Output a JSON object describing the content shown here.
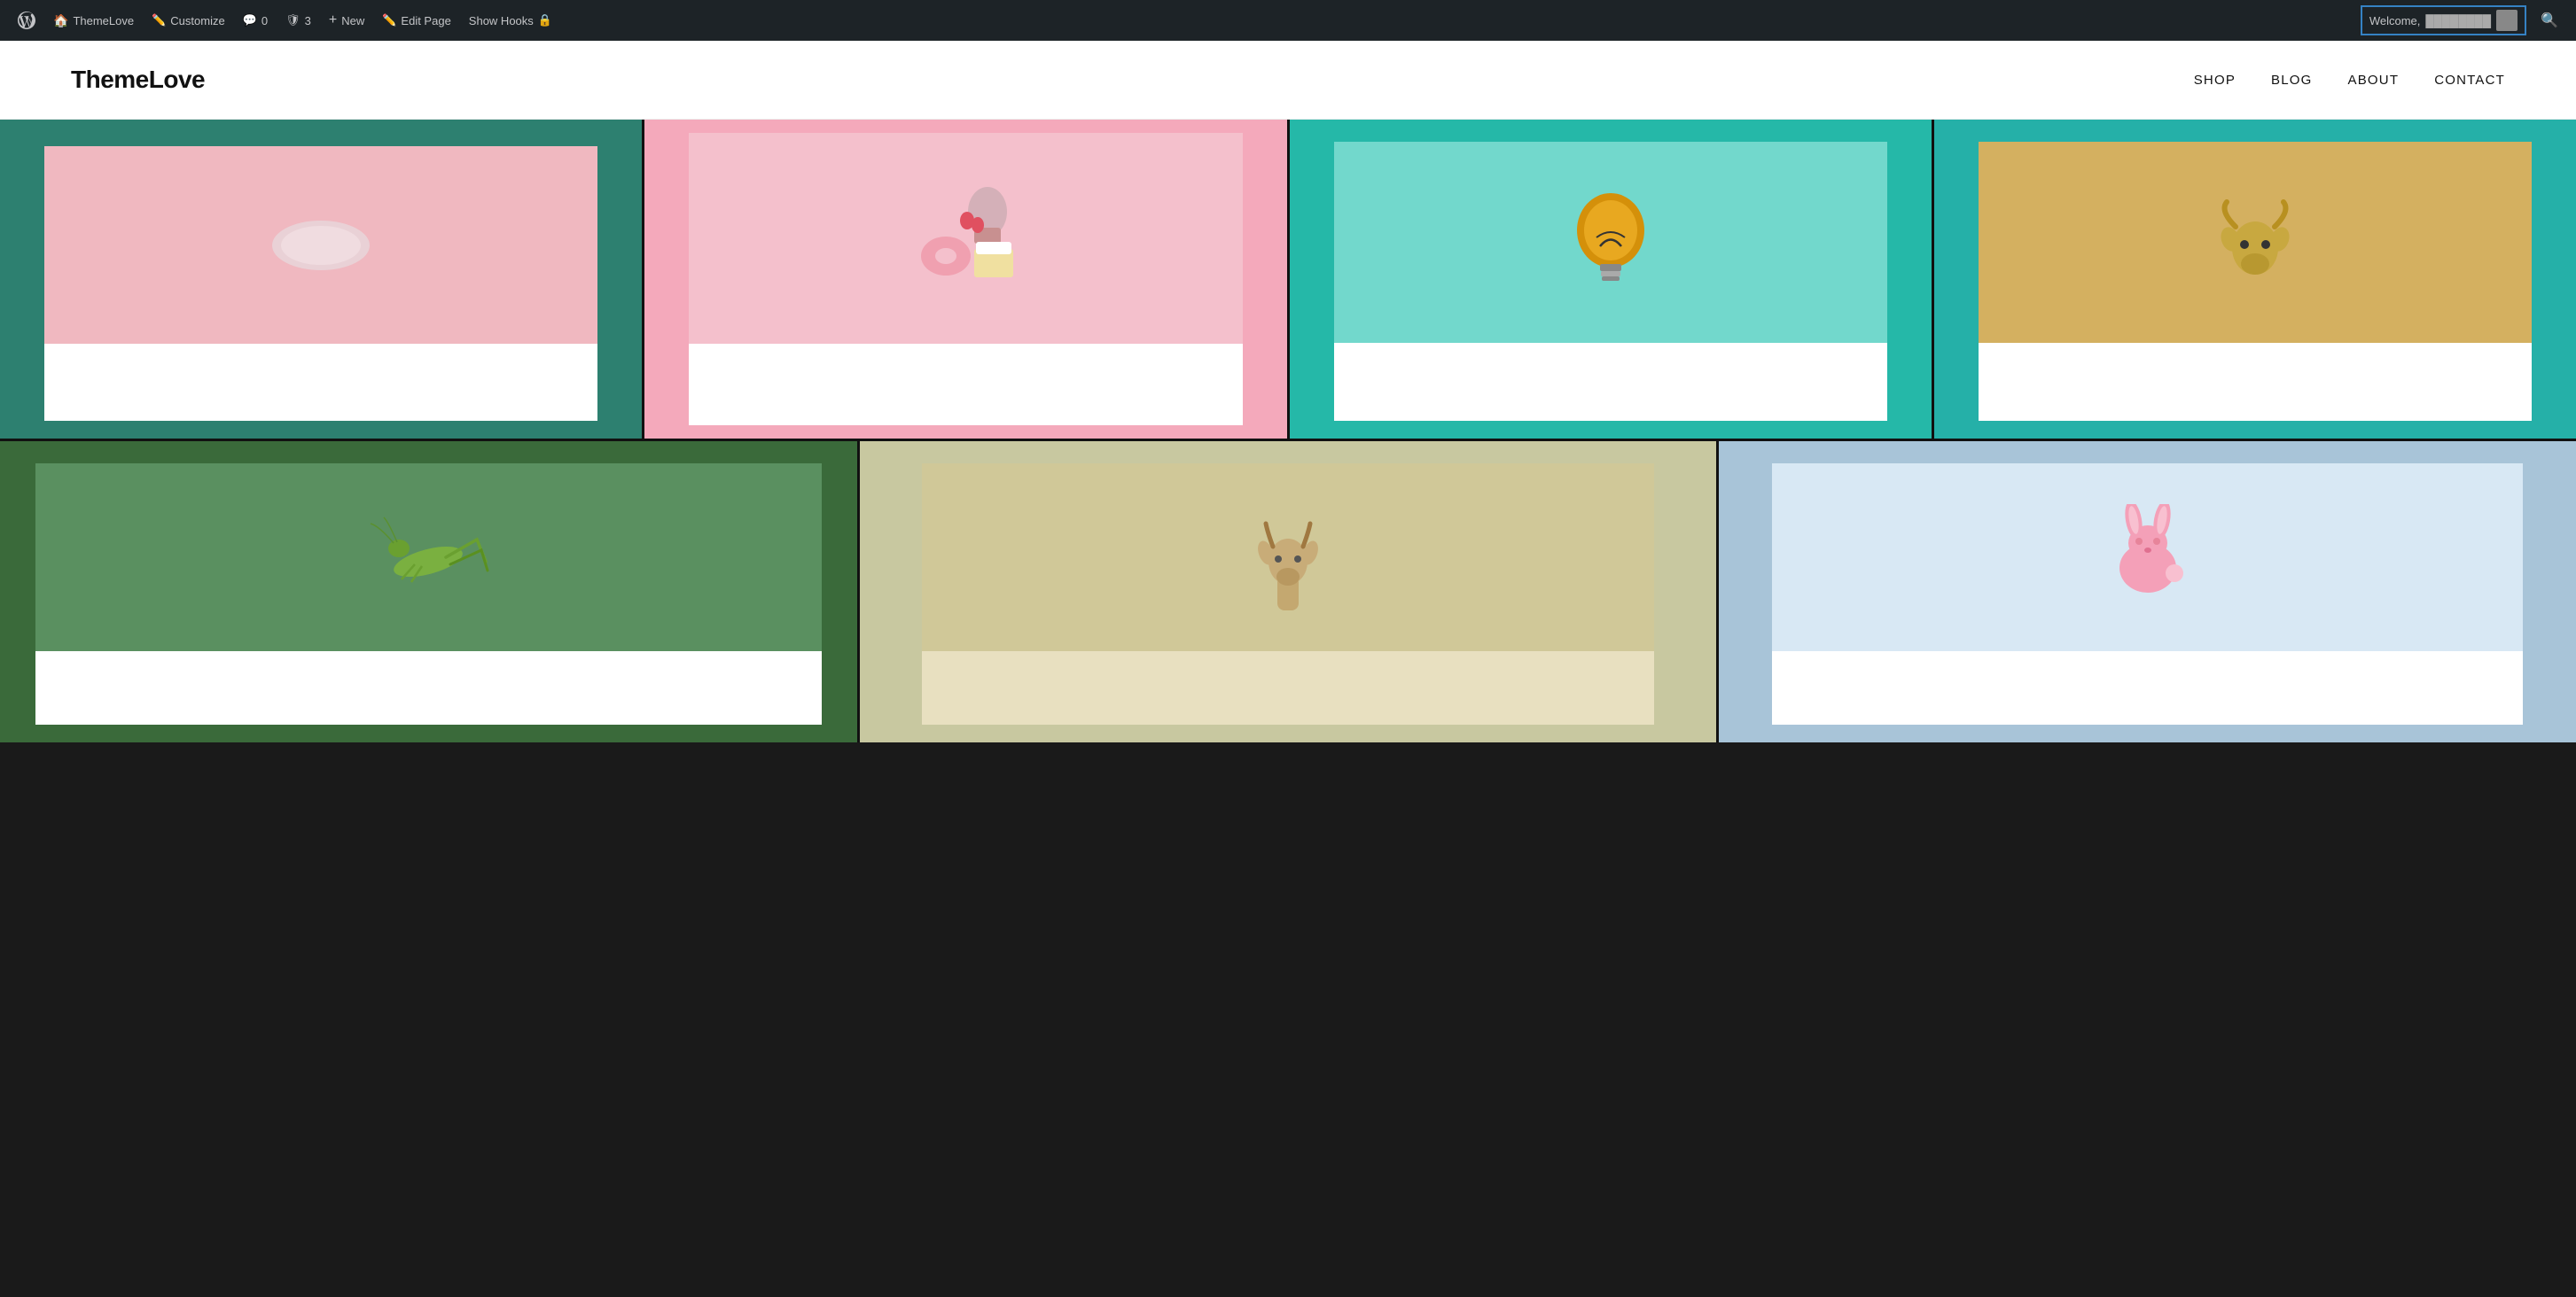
{
  "adminBar": {
    "items": [
      {
        "id": "wp-logo",
        "icon": "⊞",
        "label": ""
      },
      {
        "id": "site-name",
        "icon": "🏠",
        "label": "ThemeLove"
      },
      {
        "id": "customize",
        "icon": "✏️",
        "label": "Customize"
      },
      {
        "id": "comments",
        "icon": "💬",
        "label": "0"
      },
      {
        "id": "security",
        "icon": "🛡",
        "label": "3"
      },
      {
        "id": "new",
        "icon": "+",
        "label": "New"
      },
      {
        "id": "edit-page",
        "icon": "✏️",
        "label": "Edit Page"
      },
      {
        "id": "show-hooks",
        "icon": "🔒",
        "label": "Show Hooks"
      }
    ],
    "welcome": "Welcome,",
    "welcomeUser": "username"
  },
  "header": {
    "logo": "ThemeLove",
    "nav": [
      {
        "id": "shop",
        "label": "SHOP"
      },
      {
        "id": "blog",
        "label": "BLOG"
      },
      {
        "id": "about",
        "label": "ABOUT"
      },
      {
        "id": "contact",
        "label": "CONTACT"
      }
    ]
  },
  "gallery": {
    "row1": [
      {
        "id": "cell-r1-1",
        "bg": "#2d8070",
        "cardBg": "#f0b8c0",
        "artType": "pill"
      },
      {
        "id": "cell-r1-2",
        "bg": "#f4a9bb",
        "cardBg": "#f4c0cc",
        "artType": "sweets"
      },
      {
        "id": "cell-r1-3",
        "bg": "#25b8a8",
        "cardBg": "#72d8cc",
        "artType": "bulb"
      },
      {
        "id": "cell-r1-4",
        "bg": "#25b0a8",
        "cardBg": "#d4b060",
        "artType": "goat"
      }
    ],
    "row2": [
      {
        "id": "cell-r2-1",
        "bg": "#3a6a3a",
        "cardBg": "#5a9060",
        "artType": "grasshopper"
      },
      {
        "id": "cell-r2-2",
        "bg": "#c8c8a0",
        "cardBg": "#d0c898",
        "artType": "deer"
      },
      {
        "id": "cell-r2-3",
        "bg": "#a8c4d8",
        "cardBg": "#d8e8f0",
        "artType": "rabbit"
      }
    ]
  }
}
